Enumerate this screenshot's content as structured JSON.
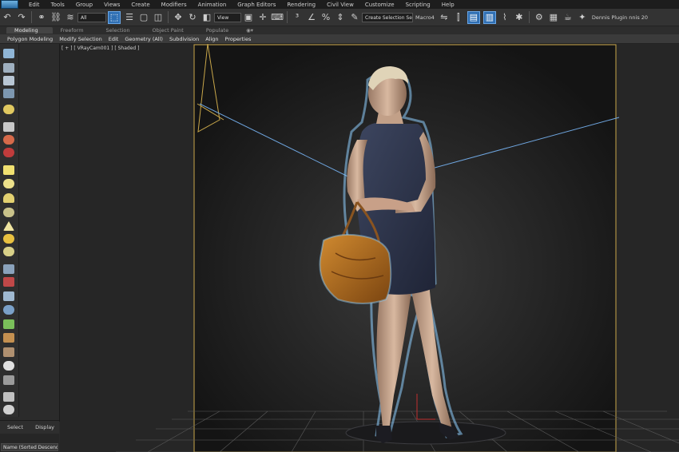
{
  "menu": [
    "Edit",
    "Tools",
    "Group",
    "Views",
    "Create",
    "Modifiers",
    "Animation",
    "Graph Editors",
    "Rendering",
    "Civil View",
    "Customize",
    "Scripting",
    "Help"
  ],
  "toolbar": {
    "filter_value": "All",
    "view_value": "View",
    "selection_set_placeholder": "Create Selection Se",
    "macro_label": "Macro4",
    "plugin_label": "Dennis Plugin  nnis 20"
  },
  "ribbon": {
    "tabs": [
      "Modeling",
      "Freeform",
      "Selection",
      "Object Paint",
      "Populate"
    ],
    "panels": [
      "Polygon Modeling",
      "Modify Selection",
      "Edit",
      "Geometry (All)",
      "Subdivision",
      "Align",
      "Properties"
    ]
  },
  "viewport": {
    "label": "[ + ] [ VRayCam001 ] [ Shaded ]"
  },
  "scene_explorer": {
    "tabs": [
      "Select",
      "Display"
    ],
    "column_header": "Name (Sorted Descending"
  },
  "colors": {
    "accent": "#2f6fb3",
    "safe_frame": "#c9a74a",
    "camera_line": "#6fa6e0",
    "selection_glow": "#8fd0ff",
    "bag": "#b46e20"
  }
}
